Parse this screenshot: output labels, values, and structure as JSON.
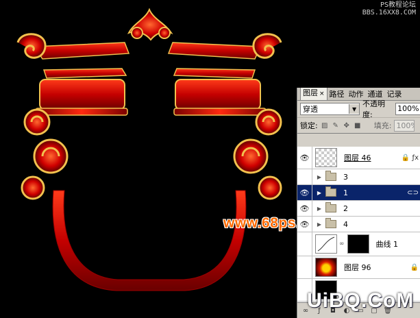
{
  "watermarks": {
    "top_line1": "PS教程论坛",
    "top_line2": "BBS.16XX8.COM",
    "site": "www.68ps.com",
    "bottom": "UiBQ.CoM"
  },
  "colors": {
    "artwork_red": "#d40000",
    "artwork_gold": "#f2c14e",
    "selected_row": "#0a246a"
  },
  "layers_panel": {
    "tabs": [
      {
        "label": "图层",
        "close": "×"
      },
      {
        "label": "路径"
      },
      {
        "label": "动作"
      },
      {
        "label": "通道"
      },
      {
        "label": "记录"
      }
    ],
    "blend_mode": "穿透",
    "opacity_label": "不透明度:",
    "opacity_value": "100%",
    "lock_label": "锁定:",
    "fill_label": "填充:",
    "fill_value": "100%",
    "layers": [
      {
        "name": "图层 46",
        "type": "layer",
        "visible": true,
        "icon": "lock-fx"
      },
      {
        "name": "3",
        "type": "group",
        "visible": false
      },
      {
        "name": "1",
        "type": "group",
        "visible": true,
        "selected": true,
        "icon": "link"
      },
      {
        "name": "2",
        "type": "group",
        "visible": true
      },
      {
        "name": "4",
        "type": "group",
        "visible": true
      },
      {
        "name": "曲线 1",
        "type": "adjustment",
        "visible": false
      },
      {
        "name": "图层 96",
        "type": "layer",
        "visible": false,
        "icon": "lock"
      },
      {
        "name": "",
        "type": "layer",
        "visible": false
      }
    ]
  }
}
